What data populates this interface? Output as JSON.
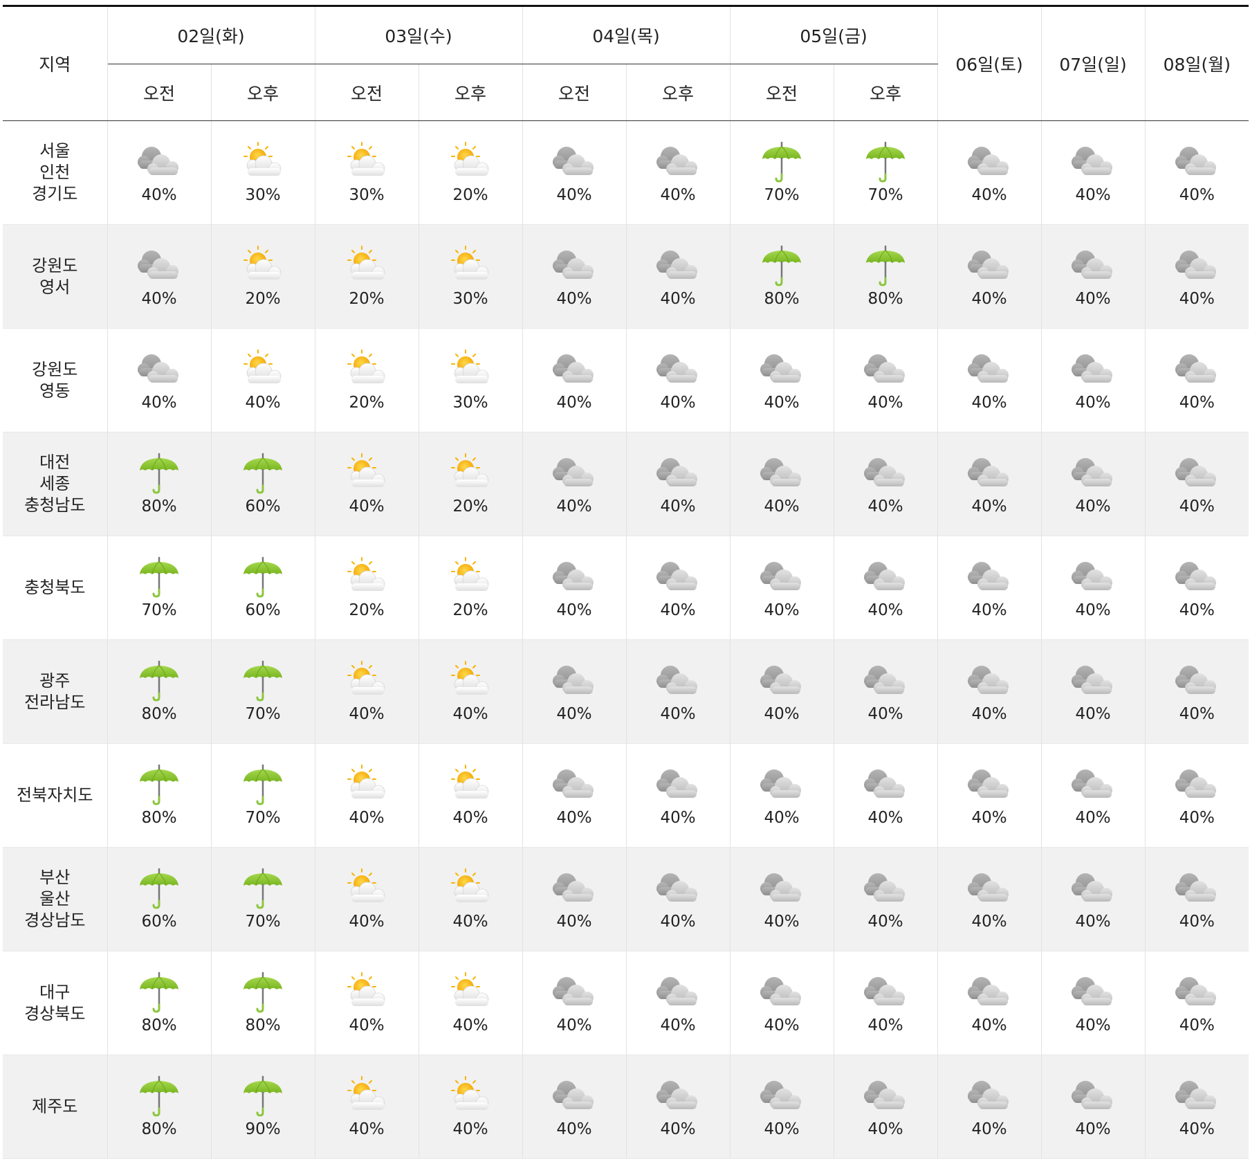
{
  "header": {
    "region_label": "지역",
    "dates": [
      {
        "label": "02일(화)",
        "split": true
      },
      {
        "label": "03일(수)",
        "split": true
      },
      {
        "label": "04일(목)",
        "split": true
      },
      {
        "label": "05일(금)",
        "split": true
      },
      {
        "label": "06일(토)",
        "split": false
      },
      {
        "label": "07일(일)",
        "split": false
      },
      {
        "label": "08일(월)",
        "split": false
      }
    ],
    "am_label": "오전",
    "pm_label": "오후"
  },
  "colors": {
    "umbrella": "#8cc63f",
    "sun": "#f7b500",
    "cloud": "#a7a7a7",
    "alt_row": "#f1f1f1"
  },
  "rows": [
    {
      "region": [
        "서울",
        "인천",
        "경기도"
      ],
      "cells": [
        {
          "icon": "cloudy-icon",
          "pct": "40%"
        },
        {
          "icon": "partly-sunny-icon",
          "pct": "30%"
        },
        {
          "icon": "partly-sunny-icon",
          "pct": "30%"
        },
        {
          "icon": "partly-sunny-icon",
          "pct": "20%"
        },
        {
          "icon": "cloudy-icon",
          "pct": "40%"
        },
        {
          "icon": "cloudy-icon",
          "pct": "40%"
        },
        {
          "icon": "umbrella-icon",
          "pct": "70%"
        },
        {
          "icon": "umbrella-icon",
          "pct": "70%"
        },
        {
          "icon": "cloudy-icon",
          "pct": "40%"
        },
        {
          "icon": "cloudy-icon",
          "pct": "40%"
        },
        {
          "icon": "cloudy-icon",
          "pct": "40%"
        }
      ]
    },
    {
      "region": [
        "강원도",
        "영서"
      ],
      "cells": [
        {
          "icon": "cloudy-icon",
          "pct": "40%"
        },
        {
          "icon": "partly-sunny-icon",
          "pct": "20%"
        },
        {
          "icon": "partly-sunny-icon",
          "pct": "20%"
        },
        {
          "icon": "partly-sunny-icon",
          "pct": "30%"
        },
        {
          "icon": "cloudy-icon",
          "pct": "40%"
        },
        {
          "icon": "cloudy-icon",
          "pct": "40%"
        },
        {
          "icon": "umbrella-icon",
          "pct": "80%"
        },
        {
          "icon": "umbrella-icon",
          "pct": "80%"
        },
        {
          "icon": "cloudy-icon",
          "pct": "40%"
        },
        {
          "icon": "cloudy-icon",
          "pct": "40%"
        },
        {
          "icon": "cloudy-icon",
          "pct": "40%"
        }
      ]
    },
    {
      "region": [
        "강원도",
        "영동"
      ],
      "cells": [
        {
          "icon": "cloudy-icon",
          "pct": "40%"
        },
        {
          "icon": "partly-sunny-icon",
          "pct": "40%"
        },
        {
          "icon": "partly-sunny-icon",
          "pct": "20%"
        },
        {
          "icon": "partly-sunny-icon",
          "pct": "30%"
        },
        {
          "icon": "cloudy-icon",
          "pct": "40%"
        },
        {
          "icon": "cloudy-icon",
          "pct": "40%"
        },
        {
          "icon": "cloudy-icon",
          "pct": "40%"
        },
        {
          "icon": "cloudy-icon",
          "pct": "40%"
        },
        {
          "icon": "cloudy-icon",
          "pct": "40%"
        },
        {
          "icon": "cloudy-icon",
          "pct": "40%"
        },
        {
          "icon": "cloudy-icon",
          "pct": "40%"
        }
      ]
    },
    {
      "region": [
        "대전",
        "세종",
        "충청남도"
      ],
      "cells": [
        {
          "icon": "umbrella-icon",
          "pct": "80%"
        },
        {
          "icon": "umbrella-icon",
          "pct": "60%"
        },
        {
          "icon": "partly-sunny-icon",
          "pct": "40%"
        },
        {
          "icon": "partly-sunny-icon",
          "pct": "20%"
        },
        {
          "icon": "cloudy-icon",
          "pct": "40%"
        },
        {
          "icon": "cloudy-icon",
          "pct": "40%"
        },
        {
          "icon": "cloudy-icon",
          "pct": "40%"
        },
        {
          "icon": "cloudy-icon",
          "pct": "40%"
        },
        {
          "icon": "cloudy-icon",
          "pct": "40%"
        },
        {
          "icon": "cloudy-icon",
          "pct": "40%"
        },
        {
          "icon": "cloudy-icon",
          "pct": "40%"
        }
      ]
    },
    {
      "region": [
        "충청북도"
      ],
      "cells": [
        {
          "icon": "umbrella-icon",
          "pct": "70%"
        },
        {
          "icon": "umbrella-icon",
          "pct": "60%"
        },
        {
          "icon": "partly-sunny-icon",
          "pct": "20%"
        },
        {
          "icon": "partly-sunny-icon",
          "pct": "20%"
        },
        {
          "icon": "cloudy-icon",
          "pct": "40%"
        },
        {
          "icon": "cloudy-icon",
          "pct": "40%"
        },
        {
          "icon": "cloudy-icon",
          "pct": "40%"
        },
        {
          "icon": "cloudy-icon",
          "pct": "40%"
        },
        {
          "icon": "cloudy-icon",
          "pct": "40%"
        },
        {
          "icon": "cloudy-icon",
          "pct": "40%"
        },
        {
          "icon": "cloudy-icon",
          "pct": "40%"
        }
      ]
    },
    {
      "region": [
        "광주",
        "전라남도"
      ],
      "cells": [
        {
          "icon": "umbrella-icon",
          "pct": "80%"
        },
        {
          "icon": "umbrella-icon",
          "pct": "70%"
        },
        {
          "icon": "partly-sunny-icon",
          "pct": "40%"
        },
        {
          "icon": "partly-sunny-icon",
          "pct": "40%"
        },
        {
          "icon": "cloudy-icon",
          "pct": "40%"
        },
        {
          "icon": "cloudy-icon",
          "pct": "40%"
        },
        {
          "icon": "cloudy-icon",
          "pct": "40%"
        },
        {
          "icon": "cloudy-icon",
          "pct": "40%"
        },
        {
          "icon": "cloudy-icon",
          "pct": "40%"
        },
        {
          "icon": "cloudy-icon",
          "pct": "40%"
        },
        {
          "icon": "cloudy-icon",
          "pct": "40%"
        }
      ]
    },
    {
      "region": [
        "전북자치도"
      ],
      "cells": [
        {
          "icon": "umbrella-icon",
          "pct": "80%"
        },
        {
          "icon": "umbrella-icon",
          "pct": "70%"
        },
        {
          "icon": "partly-sunny-icon",
          "pct": "40%"
        },
        {
          "icon": "partly-sunny-icon",
          "pct": "40%"
        },
        {
          "icon": "cloudy-icon",
          "pct": "40%"
        },
        {
          "icon": "cloudy-icon",
          "pct": "40%"
        },
        {
          "icon": "cloudy-icon",
          "pct": "40%"
        },
        {
          "icon": "cloudy-icon",
          "pct": "40%"
        },
        {
          "icon": "cloudy-icon",
          "pct": "40%"
        },
        {
          "icon": "cloudy-icon",
          "pct": "40%"
        },
        {
          "icon": "cloudy-icon",
          "pct": "40%"
        }
      ]
    },
    {
      "region": [
        "부산",
        "울산",
        "경상남도"
      ],
      "cells": [
        {
          "icon": "umbrella-icon",
          "pct": "60%"
        },
        {
          "icon": "umbrella-icon",
          "pct": "70%"
        },
        {
          "icon": "partly-sunny-icon",
          "pct": "40%"
        },
        {
          "icon": "partly-sunny-icon",
          "pct": "40%"
        },
        {
          "icon": "cloudy-icon",
          "pct": "40%"
        },
        {
          "icon": "cloudy-icon",
          "pct": "40%"
        },
        {
          "icon": "cloudy-icon",
          "pct": "40%"
        },
        {
          "icon": "cloudy-icon",
          "pct": "40%"
        },
        {
          "icon": "cloudy-icon",
          "pct": "40%"
        },
        {
          "icon": "cloudy-icon",
          "pct": "40%"
        },
        {
          "icon": "cloudy-icon",
          "pct": "40%"
        }
      ]
    },
    {
      "region": [
        "대구",
        "경상북도"
      ],
      "cells": [
        {
          "icon": "umbrella-icon",
          "pct": "80%"
        },
        {
          "icon": "umbrella-icon",
          "pct": "80%"
        },
        {
          "icon": "partly-sunny-icon",
          "pct": "40%"
        },
        {
          "icon": "partly-sunny-icon",
          "pct": "40%"
        },
        {
          "icon": "cloudy-icon",
          "pct": "40%"
        },
        {
          "icon": "cloudy-icon",
          "pct": "40%"
        },
        {
          "icon": "cloudy-icon",
          "pct": "40%"
        },
        {
          "icon": "cloudy-icon",
          "pct": "40%"
        },
        {
          "icon": "cloudy-icon",
          "pct": "40%"
        },
        {
          "icon": "cloudy-icon",
          "pct": "40%"
        },
        {
          "icon": "cloudy-icon",
          "pct": "40%"
        }
      ]
    },
    {
      "region": [
        "제주도"
      ],
      "cells": [
        {
          "icon": "umbrella-icon",
          "pct": "80%"
        },
        {
          "icon": "umbrella-icon",
          "pct": "90%"
        },
        {
          "icon": "partly-sunny-icon",
          "pct": "40%"
        },
        {
          "icon": "partly-sunny-icon",
          "pct": "40%"
        },
        {
          "icon": "cloudy-icon",
          "pct": "40%"
        },
        {
          "icon": "cloudy-icon",
          "pct": "40%"
        },
        {
          "icon": "cloudy-icon",
          "pct": "40%"
        },
        {
          "icon": "cloudy-icon",
          "pct": "40%"
        },
        {
          "icon": "cloudy-icon",
          "pct": "40%"
        },
        {
          "icon": "cloudy-icon",
          "pct": "40%"
        },
        {
          "icon": "cloudy-icon",
          "pct": "40%"
        }
      ]
    }
  ]
}
